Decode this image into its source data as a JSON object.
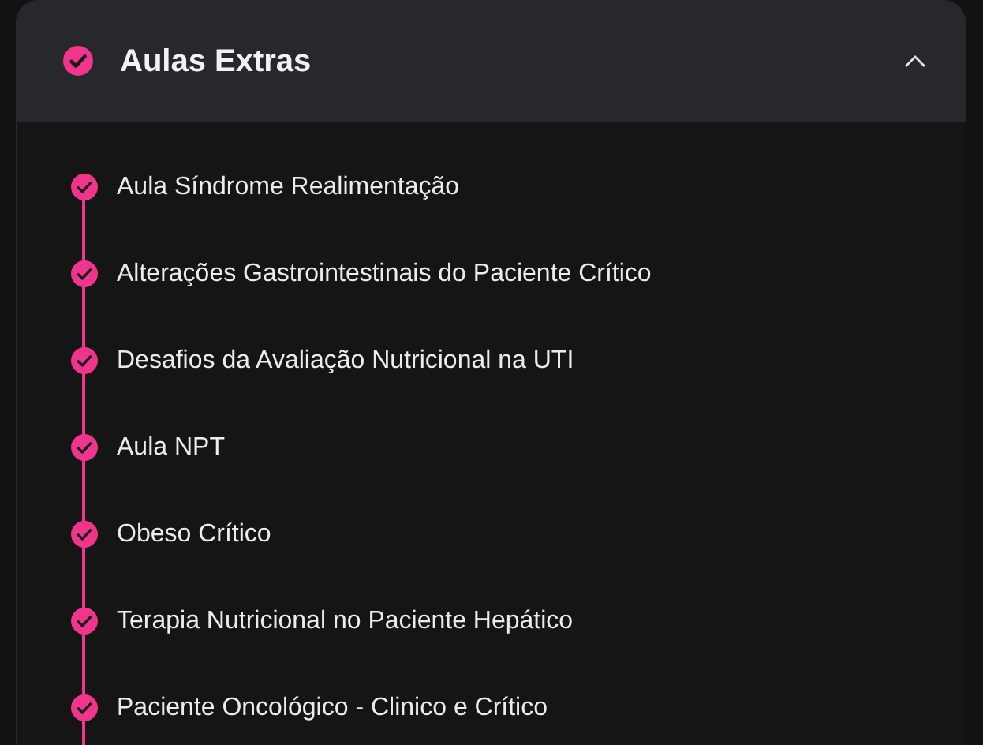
{
  "section": {
    "title": "Aulas Extras",
    "completed": true,
    "expanded": true
  },
  "lessons": [
    {
      "title": "Aula Síndrome Realimentação",
      "completed": true
    },
    {
      "title": "Alterações Gastrointestinais do Paciente Crítico",
      "completed": true
    },
    {
      "title": "Desafios da Avaliação Nutricional na UTI",
      "completed": true
    },
    {
      "title": "Aula NPT",
      "completed": true
    },
    {
      "title": "Obeso Crítico",
      "completed": true
    },
    {
      "title": "Terapia Nutricional no Paciente Hepático",
      "completed": true
    },
    {
      "title": "Paciente Oncológico - Clinico e Crítico",
      "completed": true
    }
  ]
}
